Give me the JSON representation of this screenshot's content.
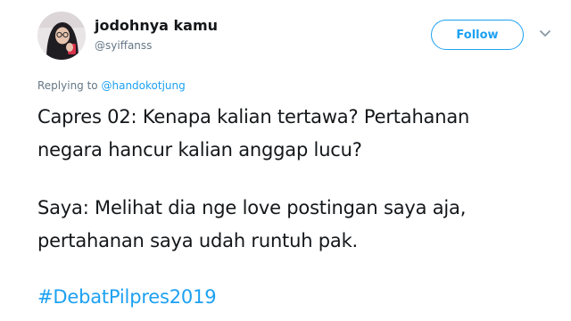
{
  "user": {
    "display_name": "jodohnya kamu",
    "handle": "@syiffanss"
  },
  "follow_button": {
    "label": "Follow"
  },
  "menu_icon": "chevron-down-icon",
  "reply_context": {
    "prefix": "Replying to",
    "mention": "@handokotjung"
  },
  "tweet": {
    "lines": [
      "Capres 02: Kenapa kalian tertawa? Pertahanan",
      "negara hancur kalian anggap lucu?",
      "Saya: Melihat dia nge love postingan saya aja,",
      "pertahanan saya udah runtuh pak."
    ],
    "hashtag": "#DebatPilpres2019"
  },
  "colors": {
    "accent": "#1da1f2",
    "text": "#14171a",
    "muted": "#657786"
  }
}
